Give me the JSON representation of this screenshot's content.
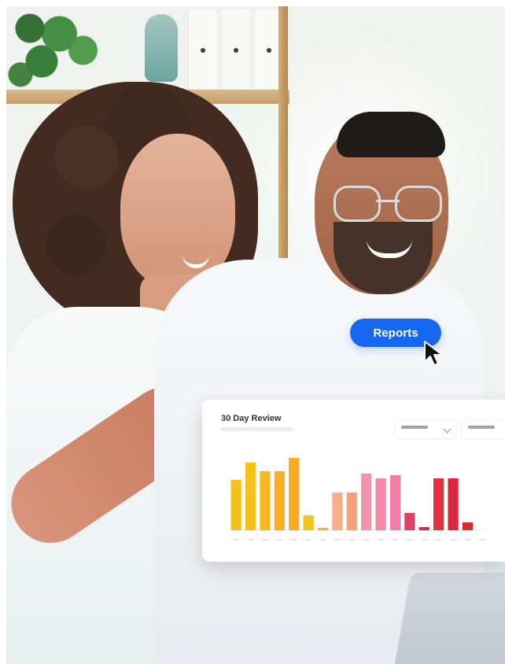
{
  "cta": {
    "label": "Reports"
  },
  "report_card": {
    "title": "30 Day Review"
  },
  "icons": {
    "cursor": "cursor-icon",
    "chevron": "chevron-down-icon"
  },
  "colors": {
    "accent": "#1467f0"
  },
  "chart_data": {
    "type": "bar",
    "title": "30 Day Review",
    "categories": [
      1,
      2,
      3,
      4,
      5,
      6,
      7,
      8,
      9,
      10,
      11,
      12,
      13,
      14,
      15,
      16,
      17,
      18
    ],
    "values": [
      64,
      86,
      75,
      75,
      92,
      19,
      3,
      48,
      48,
      72,
      66,
      70,
      22,
      4,
      66,
      66,
      10,
      0
    ],
    "ylim": [
      0,
      100
    ],
    "colors": [
      "#f2c21b",
      "#f5c11d",
      "#f8b623",
      "#f7b126",
      "#f6ad24",
      "#f4c31f",
      "#f1b82f",
      "#f8ae88",
      "#f7a07b",
      "#f195ae",
      "#f287a7",
      "#ee7ea4",
      "#db4365",
      "#db2a4b",
      "#e2313e",
      "#dc273f",
      "#da2c2f",
      "#dd3e3e"
    ]
  }
}
